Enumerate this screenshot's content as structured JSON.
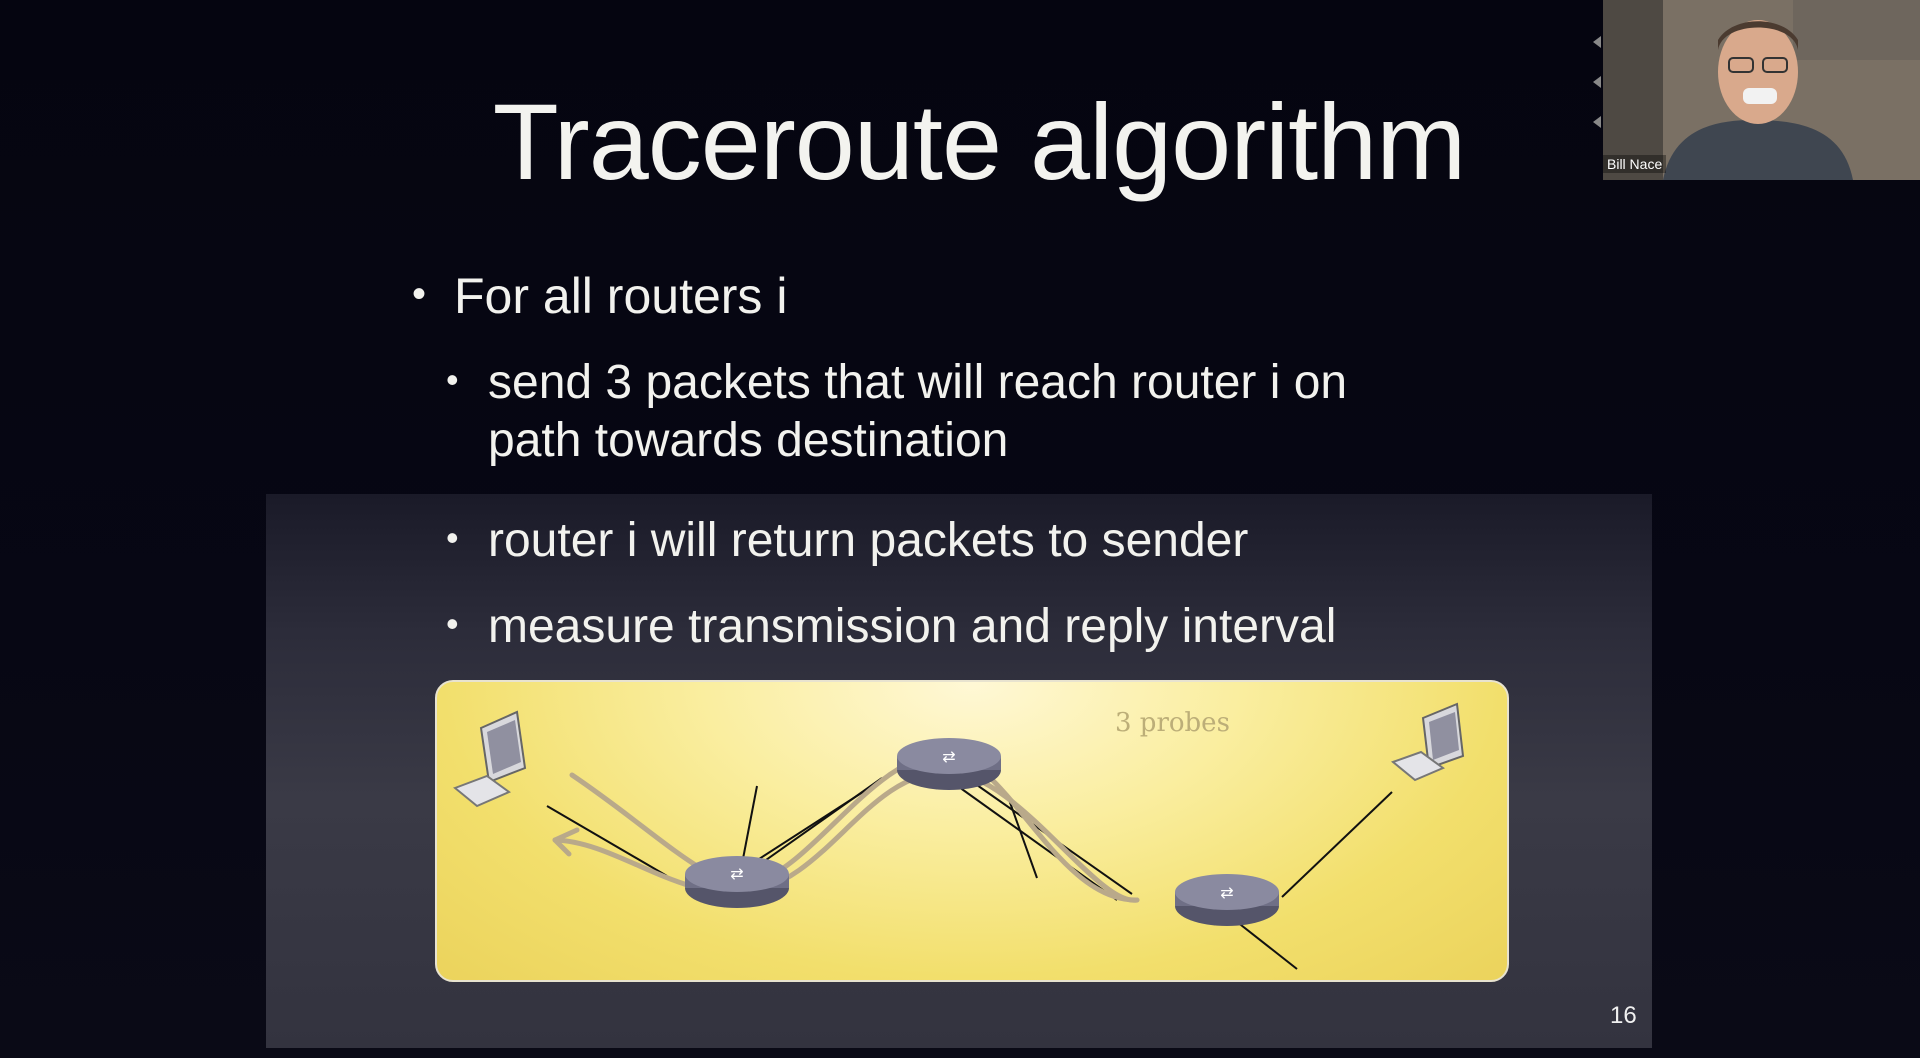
{
  "slide": {
    "title": "Traceroute algorithm",
    "bullets": [
      {
        "text": "For all routers i"
      },
      {
        "text": "send 3 packets that will reach router i on path towards destination"
      },
      {
        "text": "router i will return packets to sender"
      },
      {
        "text": "measure transmission and reply interval"
      }
    ],
    "diagram": {
      "label": "3 probes"
    },
    "page_number": "16"
  },
  "video": {
    "participant_name": "Bill Nace"
  },
  "colors": {
    "background": "#050510",
    "title_text": "#f3f3ef",
    "diagram_fill": "#f2df6c",
    "probe_path": "#b9a98a",
    "router": "#6f6f86"
  }
}
